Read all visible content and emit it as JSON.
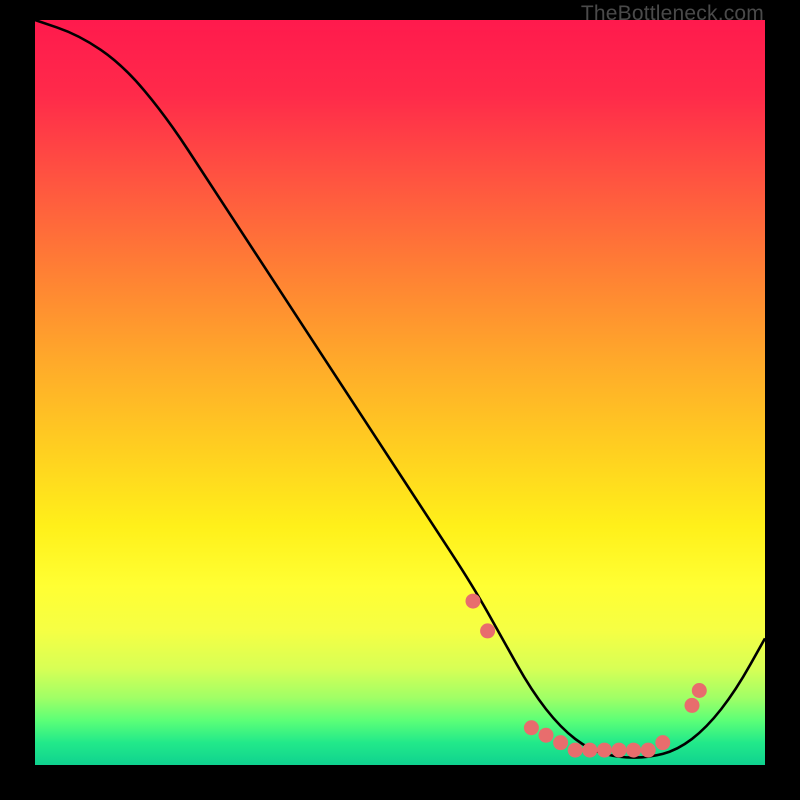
{
  "watermark": "TheBottleneck.com",
  "chart_data": {
    "type": "line",
    "title": "",
    "xlabel": "",
    "ylabel": "",
    "xlim": [
      0,
      100
    ],
    "ylim": [
      0,
      100
    ],
    "series": [
      {
        "name": "bottleneck-curve",
        "x": [
          0,
          6,
          12,
          18,
          24,
          30,
          36,
          42,
          48,
          54,
          60,
          64,
          68,
          72,
          76,
          80,
          84,
          88,
          92,
          96,
          100
        ],
        "y": [
          100,
          98,
          94,
          87,
          78,
          69,
          60,
          51,
          42,
          33,
          24,
          17,
          10,
          5,
          2,
          1,
          1,
          2,
          5,
          10,
          17
        ]
      }
    ],
    "markers": {
      "name": "highlight-dots",
      "color": "#e86d6d",
      "x": [
        60,
        62,
        68,
        70,
        72,
        74,
        76,
        78,
        80,
        82,
        84,
        86,
        90,
        91
      ],
      "y": [
        22,
        18,
        5,
        4,
        3,
        2,
        2,
        2,
        2,
        2,
        2,
        3,
        8,
        10
      ]
    }
  }
}
